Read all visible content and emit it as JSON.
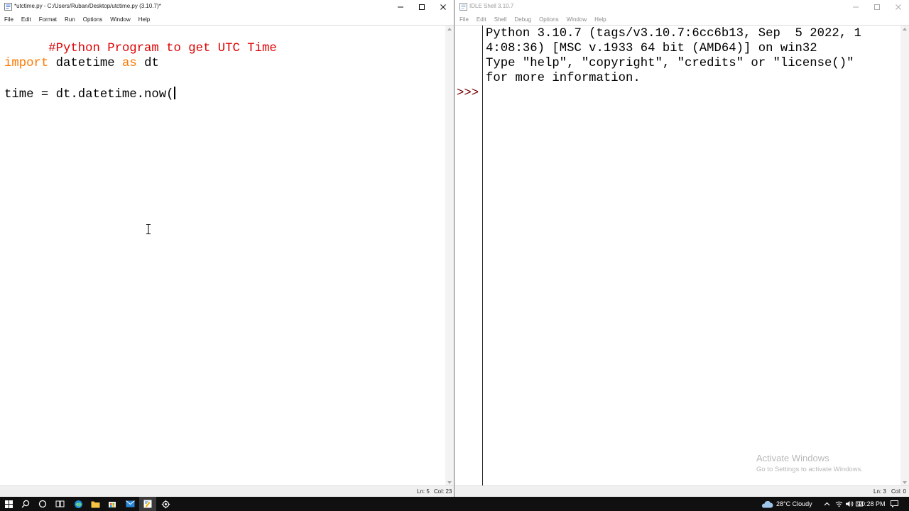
{
  "editor": {
    "title": "*utctime.py - C:/Users/Ruban/Desktop/utctime.py (3.10.7)*",
    "menu": [
      "File",
      "Edit",
      "Format",
      "Run",
      "Options",
      "Window",
      "Help"
    ],
    "code": {
      "line1": "#Python Program to get UTC Time",
      "line3_keyword1": "import",
      "line3_text1": " datetime ",
      "line3_keyword2": "as",
      "line3_text2": " dt",
      "line5": "time = dt.datetime.now("
    },
    "status": {
      "ln": "Ln: 5",
      "col": "Col: 23"
    }
  },
  "shell": {
    "title": "IDLE Shell 3.10.7",
    "menu": [
      "File",
      "Edit",
      "Shell",
      "Debug",
      "Options",
      "Window",
      "Help"
    ],
    "output": [
      "Python 3.10.7 (tags/v3.10.7:6cc6b13, Sep  5 2022, 1",
      "4:08:36) [MSC v.1933 64 bit (AMD64)] on win32",
      "Type \"help\", \"copyright\", \"credits\" or \"license()\"",
      "for more information."
    ],
    "prompt": ">>>",
    "status": {
      "ln": "Ln: 3",
      "col": "Col: 0"
    }
  },
  "watermark": {
    "title": "Activate Windows",
    "subtitle": "Go to Settings to activate Windows."
  },
  "taskbar": {
    "weather": "28°C  Cloudy",
    "time": "10:28 PM"
  }
}
